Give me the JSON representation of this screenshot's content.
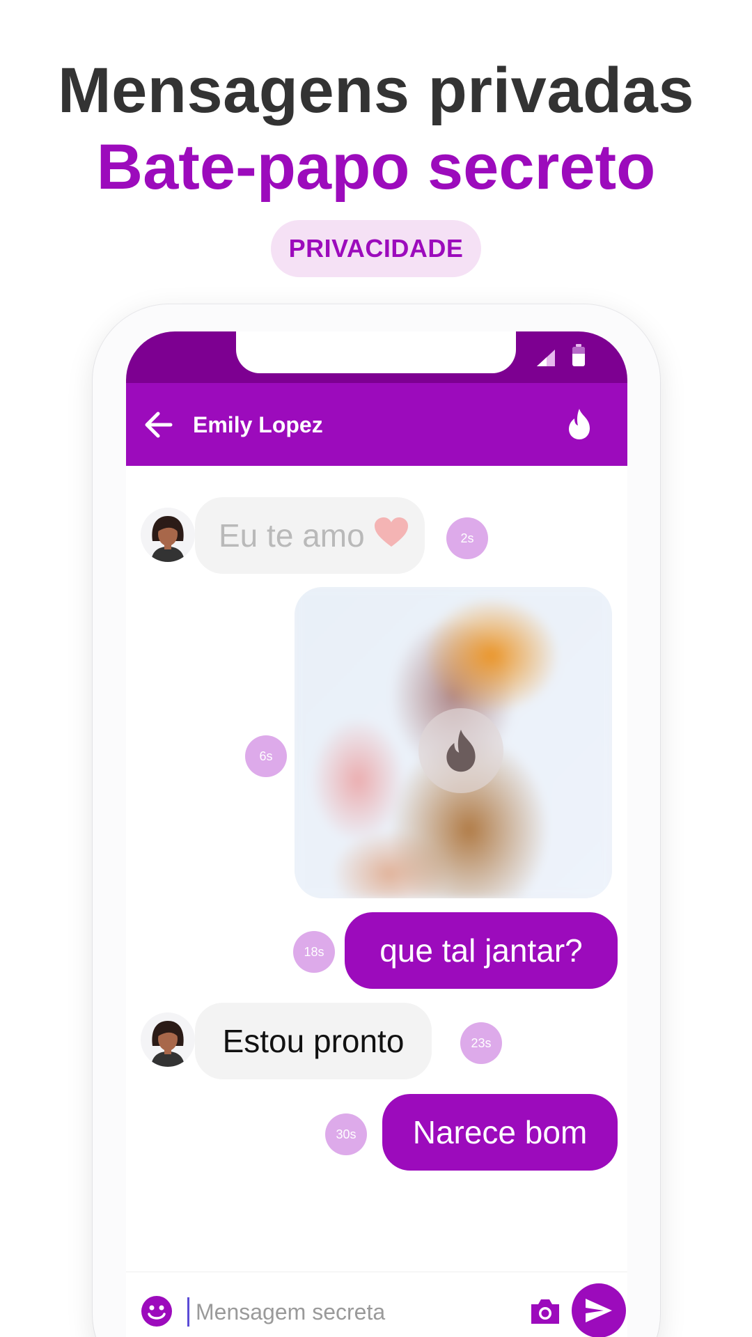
{
  "promo": {
    "headline": "Mensagens privadas",
    "subheadline": "Bate-papo secreto",
    "tag": "PRIVACIDADE"
  },
  "chat": {
    "contact_name": "Emily Lopez",
    "messages": [
      {
        "direction": "in",
        "text": "Eu te amo",
        "emoji": "heart",
        "timer": "2s",
        "faded": true
      },
      {
        "direction": "out",
        "type": "image",
        "timer": "6s"
      },
      {
        "direction": "out",
        "text": "que tal jantar?",
        "timer": "18s"
      },
      {
        "direction": "in",
        "text": "Estou pronto",
        "timer": "23s"
      },
      {
        "direction": "out",
        "text": "Narece bom",
        "timer": "30s"
      }
    ]
  },
  "composer": {
    "placeholder": "Mensagem secreta"
  },
  "icons": {
    "back": "arrow-left-icon",
    "burn": "flame-icon",
    "emoji": "smiley-icon",
    "camera": "camera-icon",
    "send": "send-icon"
  },
  "colors": {
    "brand": "#9c0bbc",
    "status_bar": "#7d0091",
    "timer_badge": "#ddaaea",
    "incoming_bubble": "#f3f3f3",
    "pill_bg": "#f5e1f5",
    "headline": "#333333"
  }
}
